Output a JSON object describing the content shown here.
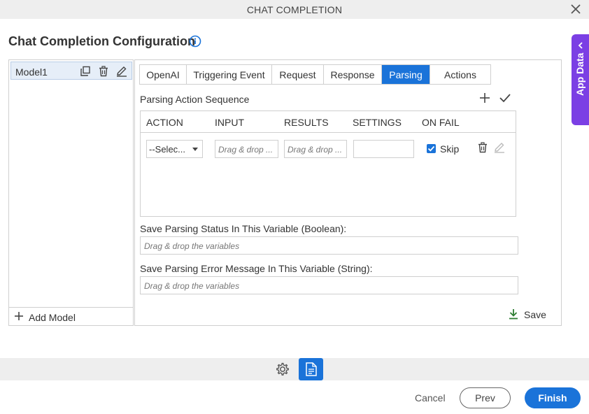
{
  "window": {
    "title": "CHAT COMPLETION",
    "close_icon": "close-icon"
  },
  "page": {
    "title": "Chat Completion Configuration",
    "info_icon": "info-icon"
  },
  "app_data": {
    "label": "App Data"
  },
  "models": {
    "items": [
      {
        "name": "Model1"
      }
    ],
    "add_label": "Add Model"
  },
  "tabs": [
    {
      "label": "OpenAI",
      "active": false
    },
    {
      "label": "Triggering Event",
      "active": false
    },
    {
      "label": "Request",
      "active": false
    },
    {
      "label": "Response",
      "active": false
    },
    {
      "label": "Parsing",
      "active": true
    },
    {
      "label": "Actions",
      "active": false
    }
  ],
  "parsing": {
    "section_label": "Parsing Action Sequence",
    "columns": [
      "ACTION",
      "INPUT",
      "RESULTS",
      "SETTINGS",
      "ON FAIL"
    ],
    "row": {
      "action_value": "--Selec...",
      "input_placeholder": "Drag & drop ...",
      "results_placeholder": "Drag & drop ...",
      "settings_value": "",
      "on_fail_checked": true,
      "on_fail_label": "Skip"
    },
    "status_label": "Save Parsing Status In This Variable (Boolean):",
    "status_placeholder": "Drag & drop the variables",
    "error_label": "Save Parsing Error Message In This Variable (String):",
    "error_placeholder": "Drag & drop the variables",
    "save_label": "Save"
  },
  "footer": {
    "cancel_label": "Cancel",
    "prev_label": "Prev",
    "finish_label": "Finish"
  },
  "colors": {
    "accent": "#1a73d9",
    "app_data": "#7b3fe4",
    "save_icon": "#2e7d32"
  }
}
